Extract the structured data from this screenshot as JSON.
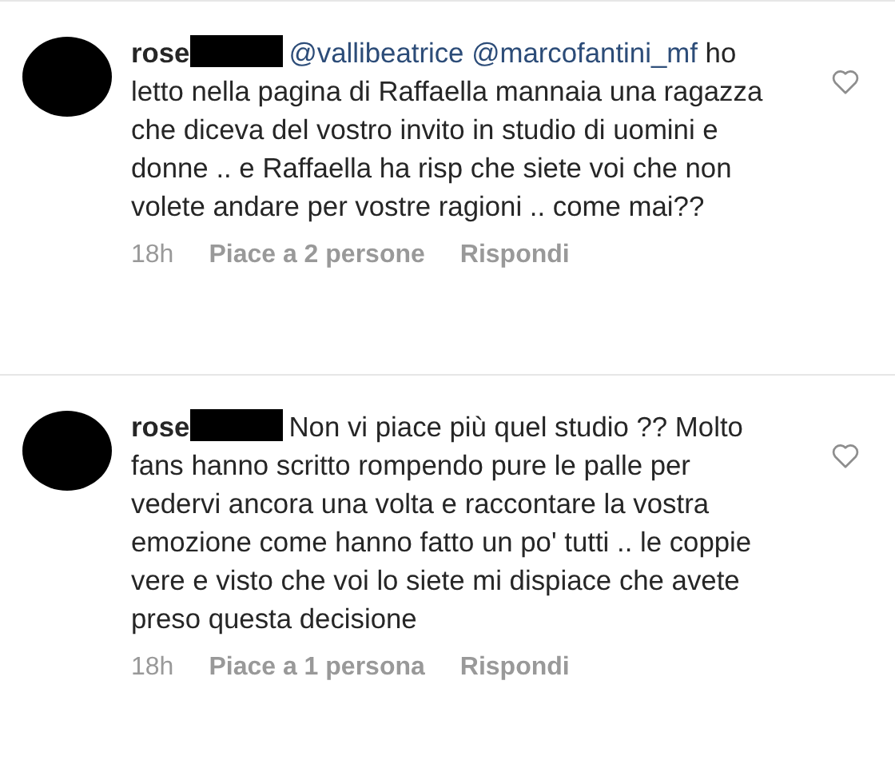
{
  "comments": [
    {
      "username": "rose",
      "redacted": true,
      "liked": false,
      "body": [
        {
          "kind": "mention",
          "text": "@vallibeatrice"
        },
        {
          "kind": "mention",
          "text": "@marcofantini_mf"
        },
        {
          "kind": "text",
          "text": "ho letto nella pagina di Raffaella mannaia una ragazza che diceva del vostro invito in studio di uomini e donne .. e Raffaella ha risp che siete voi che non volete andare per vostre ragioni .. come mai??"
        }
      ],
      "time": "18h",
      "likes": "Piace a 2 persone",
      "reply": "Rispondi"
    },
    {
      "username": "rose",
      "redacted": true,
      "liked": false,
      "body": [
        {
          "kind": "text",
          "text": "Non vi piace più quel studio ?? Molto fans hanno scritto rompendo pure le palle per vedervi ancora una volta e raccontare la vostra emozione come hanno fatto un po' tutti .. le coppie vere e visto che voi lo siete mi dispiace che avete preso questa decisione"
        }
      ],
      "time": "18h",
      "likes": "Piace a 1 persona",
      "reply": "Rispondi"
    }
  ]
}
